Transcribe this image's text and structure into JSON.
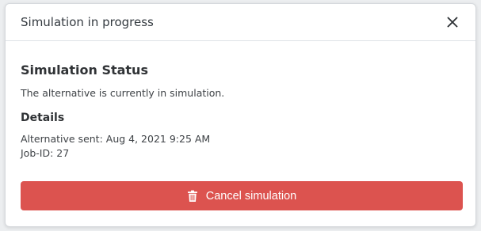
{
  "modal": {
    "title": "Simulation in progress",
    "close_icon": "close-icon"
  },
  "status": {
    "heading": "Simulation Status",
    "message": "The alternative is currently in simulation."
  },
  "details": {
    "heading": "Details",
    "alternative_sent": "Alternative sent: Aug 4, 2021 9:25 AM",
    "job_id": "Job-ID: 27"
  },
  "actions": {
    "cancel_label": "Cancel simulation",
    "cancel_icon": "trash-icon",
    "cancel_color": "#dc534f"
  }
}
